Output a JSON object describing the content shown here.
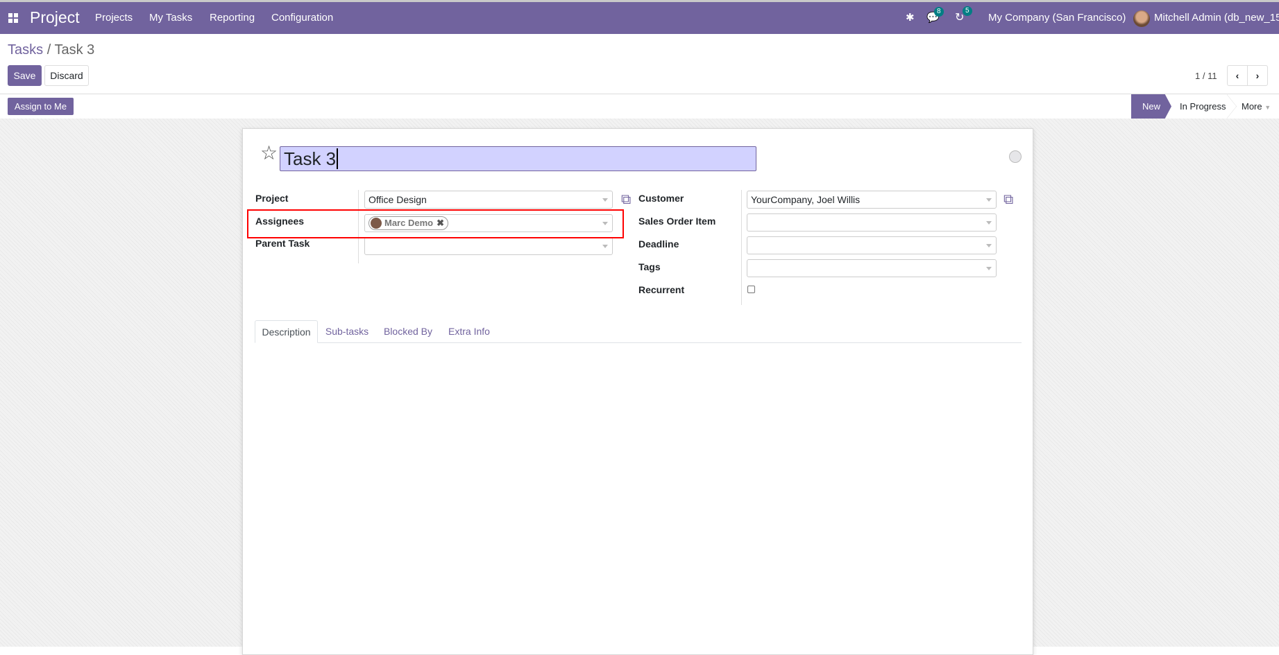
{
  "navbar": {
    "app_name": "Project",
    "menu": [
      "Projects",
      "My Tasks",
      "Reporting",
      "Configuration"
    ],
    "messages_count": "8",
    "activities_count": "5",
    "company": "My Company (San Francisco)",
    "user": "Mitchell Admin (db_new_15)"
  },
  "breadcrumb": {
    "parent": "Tasks",
    "separator": "/",
    "current": "Task 3"
  },
  "toolbar": {
    "save": "Save",
    "discard": "Discard",
    "pager": "1 / 11"
  },
  "statusbar": {
    "assign_button": "Assign to Me",
    "stages": [
      "New",
      "In Progress"
    ],
    "more": "More",
    "active_stage": "New"
  },
  "form": {
    "title": "Task 3",
    "left": {
      "project_label": "Project",
      "project_value": "Office Design",
      "assignees_label": "Assignees",
      "assignees": [
        "Marc Demo"
      ],
      "parent_label": "Parent Task",
      "parent_value": ""
    },
    "right": {
      "customer_label": "Customer",
      "customer_value": "YourCompany, Joel Willis",
      "so_label": "Sales Order Item",
      "so_value": "",
      "deadline_label": "Deadline",
      "deadline_value": "",
      "tags_label": "Tags",
      "tags_value": "",
      "recurrent_label": "Recurrent",
      "recurrent_checked": false
    },
    "tabs": [
      "Description",
      "Sub-tasks",
      "Blocked By",
      "Extra Info"
    ],
    "active_tab": "Description"
  },
  "colors": {
    "brand": "#71639e",
    "badge": "#017e84",
    "highlight": "#ff0000",
    "title_bg": "#d2d2ff"
  }
}
